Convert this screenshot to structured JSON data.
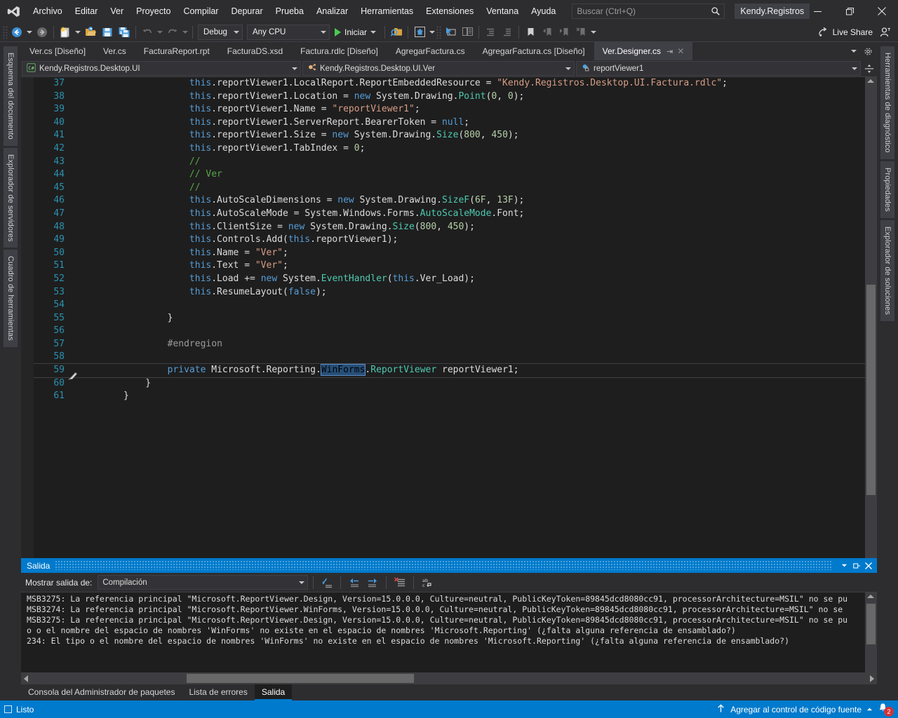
{
  "window": {
    "solution_name": "Kendy.Registros",
    "minimize_label": "—",
    "maximize_label": "❐",
    "close_label": "✕"
  },
  "menu": {
    "items": [
      {
        "label": "Archivo",
        "accel": "A"
      },
      {
        "label": "Editar",
        "accel": "E"
      },
      {
        "label": "Ver",
        "accel": "V"
      },
      {
        "label": "Proyecto",
        "accel": "P"
      },
      {
        "label": "Compilar",
        "accel": "C"
      },
      {
        "label": "Depurar",
        "accel": "D"
      },
      {
        "label": "Prueba",
        "accel": "r"
      },
      {
        "label": "Analizar",
        "accel": "z"
      },
      {
        "label": "Herramientas",
        "accel": "H"
      },
      {
        "label": "Extensiones",
        "accel": "x"
      },
      {
        "label": "Ventana",
        "accel": "n"
      },
      {
        "label": "Ayuda",
        "accel": "u"
      }
    ]
  },
  "search": {
    "placeholder": "Buscar (Ctrl+Q)",
    "value": "",
    "icon": "search-icon"
  },
  "toolbar": {
    "back_icon": "navigate-back-icon",
    "forward_icon": "navigate-forward-icon",
    "new_item_icon": "new-item-icon",
    "open_icon": "open-file-icon",
    "save_icon": "save-icon",
    "save_all_icon": "save-all-icon",
    "undo_icon": "undo-icon",
    "redo_icon": "redo-icon",
    "config_value": "Debug",
    "platform_value": "Any CPU",
    "start_label": "Iniciar",
    "start_icon": "play-icon",
    "find_icon": "find-in-files-icon",
    "home_icon": "home-icon",
    "cursor_icon": "select-element-icon",
    "compare_icon": "compare-files-icon",
    "indent_icon": "increase-indent-icon",
    "outdent_icon": "decrease-indent-icon",
    "bookmark_icon": "bookmark-icon",
    "prev_bookmark_icon": "previous-bookmark-icon",
    "next_bookmark_icon": "next-bookmark-icon",
    "clear_bookmark_icon": "clear-bookmark-icon",
    "live_share_label": "Live Share",
    "live_share_icon": "live-share-icon",
    "account_icon": "account-icon"
  },
  "left_tool_tabs": [
    {
      "label": "Esquema del documento"
    },
    {
      "label": "Explorador de servidores"
    },
    {
      "label": "Cuadro de herramientas"
    }
  ],
  "right_tool_tabs": [
    {
      "label": "Herramientas de diagnóstico"
    },
    {
      "label": "Propiedades"
    },
    {
      "label": "Explorador de soluciones"
    }
  ],
  "document_tabs": [
    {
      "label": "Ver.cs [Diseño]",
      "active": false
    },
    {
      "label": "Ver.cs",
      "active": false
    },
    {
      "label": "FacturaReport.rpt",
      "active": false
    },
    {
      "label": "FacturaDS.xsd",
      "active": false
    },
    {
      "label": "Factura.rdlc [Diseño]",
      "active": false
    },
    {
      "label": "AgregarFactura.cs",
      "active": false
    },
    {
      "label": "AgregarFactura.cs [Diseño]",
      "active": false
    },
    {
      "label": "Ver.Designer.cs",
      "active": true,
      "pin": "⇥",
      "close": "✕"
    }
  ],
  "doc_tabs_overflow_icon": "chevron-down-icon",
  "doc_tabs_settings_icon": "gear-icon",
  "navbar": {
    "namespace": "Kendy.Registros.Desktop.UI",
    "namespace_icon": "csharp-file-icon",
    "type": "Kendy.Registros.Desktop.UI.Ver",
    "type_icon": "class-icon",
    "member": "reportViewer1",
    "member_icon": "field-private-icon",
    "split_icon": "split-editor-icon"
  },
  "code": {
    "current_line": 59,
    "breakpoint_line": 59,
    "highlighted_word": "WinForms",
    "lines": [
      {
        "n": 37,
        "tokens": [
          {
            "t": "plain",
            "v": "            "
          },
          {
            "t": "kw",
            "v": "this"
          },
          {
            "t": "plain",
            "v": ".reportViewer1.LocalReport.ReportEmbeddedResource = "
          },
          {
            "t": "str",
            "v": "\"Kendy.Registros.Desktop.UI.Factura.rdlc\""
          },
          {
            "t": "plain",
            "v": ";"
          }
        ]
      },
      {
        "n": 38,
        "tokens": [
          {
            "t": "plain",
            "v": "            "
          },
          {
            "t": "kw",
            "v": "this"
          },
          {
            "t": "plain",
            "v": ".reportViewer1.Location = "
          },
          {
            "t": "kw",
            "v": "new"
          },
          {
            "t": "plain",
            "v": " System.Drawing."
          },
          {
            "t": "type",
            "v": "Point"
          },
          {
            "t": "plain",
            "v": "("
          },
          {
            "t": "num",
            "v": "0"
          },
          {
            "t": "plain",
            "v": ", "
          },
          {
            "t": "num",
            "v": "0"
          },
          {
            "t": "plain",
            "v": ");"
          }
        ]
      },
      {
        "n": 39,
        "tokens": [
          {
            "t": "plain",
            "v": "            "
          },
          {
            "t": "kw",
            "v": "this"
          },
          {
            "t": "plain",
            "v": ".reportViewer1.Name = "
          },
          {
            "t": "str",
            "v": "\"reportViewer1\""
          },
          {
            "t": "plain",
            "v": ";"
          }
        ]
      },
      {
        "n": 40,
        "tokens": [
          {
            "t": "plain",
            "v": "            "
          },
          {
            "t": "kw",
            "v": "this"
          },
          {
            "t": "plain",
            "v": ".reportViewer1.ServerReport.BearerToken = "
          },
          {
            "t": "kw",
            "v": "null"
          },
          {
            "t": "plain",
            "v": ";"
          }
        ]
      },
      {
        "n": 41,
        "tokens": [
          {
            "t": "plain",
            "v": "            "
          },
          {
            "t": "kw",
            "v": "this"
          },
          {
            "t": "plain",
            "v": ".reportViewer1.Size = "
          },
          {
            "t": "kw",
            "v": "new"
          },
          {
            "t": "plain",
            "v": " System.Drawing."
          },
          {
            "t": "type",
            "v": "Size"
          },
          {
            "t": "plain",
            "v": "("
          },
          {
            "t": "num",
            "v": "800"
          },
          {
            "t": "plain",
            "v": ", "
          },
          {
            "t": "num",
            "v": "450"
          },
          {
            "t": "plain",
            "v": ");"
          }
        ]
      },
      {
        "n": 42,
        "tokens": [
          {
            "t": "plain",
            "v": "            "
          },
          {
            "t": "kw",
            "v": "this"
          },
          {
            "t": "plain",
            "v": ".reportViewer1.TabIndex = "
          },
          {
            "t": "num",
            "v": "0"
          },
          {
            "t": "plain",
            "v": ";"
          }
        ]
      },
      {
        "n": 43,
        "tokens": [
          {
            "t": "plain",
            "v": "            "
          },
          {
            "t": "cmt",
            "v": "//"
          }
        ]
      },
      {
        "n": 44,
        "tokens": [
          {
            "t": "plain",
            "v": "            "
          },
          {
            "t": "cmt",
            "v": "// Ver"
          }
        ]
      },
      {
        "n": 45,
        "tokens": [
          {
            "t": "plain",
            "v": "            "
          },
          {
            "t": "cmt",
            "v": "//"
          }
        ]
      },
      {
        "n": 46,
        "tokens": [
          {
            "t": "plain",
            "v": "            "
          },
          {
            "t": "kw",
            "v": "this"
          },
          {
            "t": "plain",
            "v": ".AutoScaleDimensions = "
          },
          {
            "t": "kw",
            "v": "new"
          },
          {
            "t": "plain",
            "v": " System.Drawing."
          },
          {
            "t": "type",
            "v": "SizeF"
          },
          {
            "t": "plain",
            "v": "("
          },
          {
            "t": "num",
            "v": "6F"
          },
          {
            "t": "plain",
            "v": ", "
          },
          {
            "t": "num",
            "v": "13F"
          },
          {
            "t": "plain",
            "v": ");"
          }
        ]
      },
      {
        "n": 47,
        "tokens": [
          {
            "t": "plain",
            "v": "            "
          },
          {
            "t": "kw",
            "v": "this"
          },
          {
            "t": "plain",
            "v": ".AutoScaleMode = System.Windows.Forms."
          },
          {
            "t": "type",
            "v": "AutoScaleMode"
          },
          {
            "t": "plain",
            "v": ".Font;"
          }
        ]
      },
      {
        "n": 48,
        "tokens": [
          {
            "t": "plain",
            "v": "            "
          },
          {
            "t": "kw",
            "v": "this"
          },
          {
            "t": "plain",
            "v": ".ClientSize = "
          },
          {
            "t": "kw",
            "v": "new"
          },
          {
            "t": "plain",
            "v": " System.Drawing."
          },
          {
            "t": "type",
            "v": "Size"
          },
          {
            "t": "plain",
            "v": "("
          },
          {
            "t": "num",
            "v": "800"
          },
          {
            "t": "plain",
            "v": ", "
          },
          {
            "t": "num",
            "v": "450"
          },
          {
            "t": "plain",
            "v": ");"
          }
        ]
      },
      {
        "n": 49,
        "tokens": [
          {
            "t": "plain",
            "v": "            "
          },
          {
            "t": "kw",
            "v": "this"
          },
          {
            "t": "plain",
            "v": ".Controls.Add("
          },
          {
            "t": "kw",
            "v": "this"
          },
          {
            "t": "plain",
            "v": ".reportViewer1);"
          }
        ]
      },
      {
        "n": 50,
        "tokens": [
          {
            "t": "plain",
            "v": "            "
          },
          {
            "t": "kw",
            "v": "this"
          },
          {
            "t": "plain",
            "v": ".Name = "
          },
          {
            "t": "str",
            "v": "\"Ver\""
          },
          {
            "t": "plain",
            "v": ";"
          }
        ]
      },
      {
        "n": 51,
        "tokens": [
          {
            "t": "plain",
            "v": "            "
          },
          {
            "t": "kw",
            "v": "this"
          },
          {
            "t": "plain",
            "v": ".Text = "
          },
          {
            "t": "str",
            "v": "\"Ver\""
          },
          {
            "t": "plain",
            "v": ";"
          }
        ]
      },
      {
        "n": 52,
        "tokens": [
          {
            "t": "plain",
            "v": "            "
          },
          {
            "t": "kw",
            "v": "this"
          },
          {
            "t": "plain",
            "v": ".Load += "
          },
          {
            "t": "kw",
            "v": "new"
          },
          {
            "t": "plain",
            "v": " System."
          },
          {
            "t": "type",
            "v": "EventHandler"
          },
          {
            "t": "plain",
            "v": "("
          },
          {
            "t": "kw",
            "v": "this"
          },
          {
            "t": "plain",
            "v": ".Ver_Load);"
          }
        ]
      },
      {
        "n": 53,
        "tokens": [
          {
            "t": "plain",
            "v": "            "
          },
          {
            "t": "kw",
            "v": "this"
          },
          {
            "t": "plain",
            "v": ".ResumeLayout("
          },
          {
            "t": "kw",
            "v": "false"
          },
          {
            "t": "plain",
            "v": ");"
          }
        ]
      },
      {
        "n": 54,
        "tokens": [
          {
            "t": "plain",
            "v": ""
          }
        ]
      },
      {
        "n": 55,
        "tokens": [
          {
            "t": "plain",
            "v": "        }"
          }
        ]
      },
      {
        "n": 56,
        "tokens": [
          {
            "t": "plain",
            "v": ""
          }
        ]
      },
      {
        "n": 57,
        "tokens": [
          {
            "t": "plain",
            "v": "        "
          },
          {
            "t": "region",
            "v": "#endregion"
          }
        ]
      },
      {
        "n": 58,
        "tokens": [
          {
            "t": "plain",
            "v": ""
          }
        ]
      },
      {
        "n": 59,
        "tokens": [
          {
            "t": "plain",
            "v": "        "
          },
          {
            "t": "kw",
            "v": "private"
          },
          {
            "t": "plain",
            "v": " Microsoft.Reporting."
          },
          {
            "t": "hl",
            "v": "WinForms"
          },
          {
            "t": "plain",
            "v": "."
          },
          {
            "t": "type",
            "v": "ReportViewer"
          },
          {
            "t": "plain",
            "v": " reportViewer1;"
          }
        ]
      },
      {
        "n": 60,
        "tokens": [
          {
            "t": "plain",
            "v": "    }"
          }
        ]
      },
      {
        "n": 61,
        "tokens": [
          {
            "t": "plain",
            "v": "}"
          }
        ]
      }
    ]
  },
  "output_panel": {
    "title": "Salida",
    "header_icons": [
      "chevron-down-icon",
      "dock-icon",
      "close-icon"
    ],
    "show_output_label": "Mostrar salida de:",
    "show_output_value": "Compilación",
    "toolbar_icons": [
      "go-to-message-icon",
      "previous-message-icon",
      "next-message-icon",
      "clear-all-icon",
      "toggle-word-wrap-icon"
    ],
    "lines": [
      {
        "text": "MSB3275: La referencia principal \"Microsoft.ReportViewer.Design, Version=15.0.0.0, Culture=neutral, PublicKeyToken=89845dcd8080cc91, processorArchitecture=MSIL\" no se pu",
        "selected": false
      },
      {
        "text": "MSB3274: La referencia principal \"Microsoft.ReportViewer.WinForms, Version=15.0.0.0, Culture=neutral, PublicKeyToken=89845dcd8080cc91, processorArchitecture=MSIL\" no se",
        "selected": false
      },
      {
        "text": "MSB3275: La referencia principal \"Microsoft.ReportViewer.Design, Version=15.0.0.0, Culture=neutral, PublicKeyToken=89845dcd8080cc91, processorArchitecture=MSIL\" no se pu",
        "selected": false
      },
      {
        "text": "o o el nombre del espacio de nombres 'WinForms' no existe en el espacio de nombres 'Microsoft.Reporting' (¿falta alguna referencia de ensamblado?)",
        "selected": false
      },
      {
        "text": "234: El tipo o el nombre del espacio de nombres 'WinForms' no existe en el espacio de nombres 'Microsoft.Reporting' (¿falta alguna referencia de ensamblado?)",
        "selected": true
      }
    ]
  },
  "bottom_tabs": [
    {
      "label": "Consola del Administrador de paquetes",
      "active": false
    },
    {
      "label": "Lista de errores",
      "active": false
    },
    {
      "label": "Salida",
      "active": true
    }
  ],
  "status_bar": {
    "ready_label": "Listo",
    "ready_icon": "stop-icon",
    "source_control_label": "Agregar al control de código fuente",
    "source_control_icon": "upload-arrow-icon",
    "expand_icon": "chevron-up-icon",
    "notification_icon": "bell-icon",
    "notification_count": "2"
  },
  "colors": {
    "accent_blue": "#007acc",
    "chrome": "#2d2d30",
    "editor_bg": "#1e1e1e",
    "selection": "#264f78",
    "error_red": "#d13438",
    "comment_green": "#57a64a",
    "string_orange": "#d69d85",
    "keyword_blue": "#569cd6",
    "type_teal": "#4ec9b0"
  }
}
